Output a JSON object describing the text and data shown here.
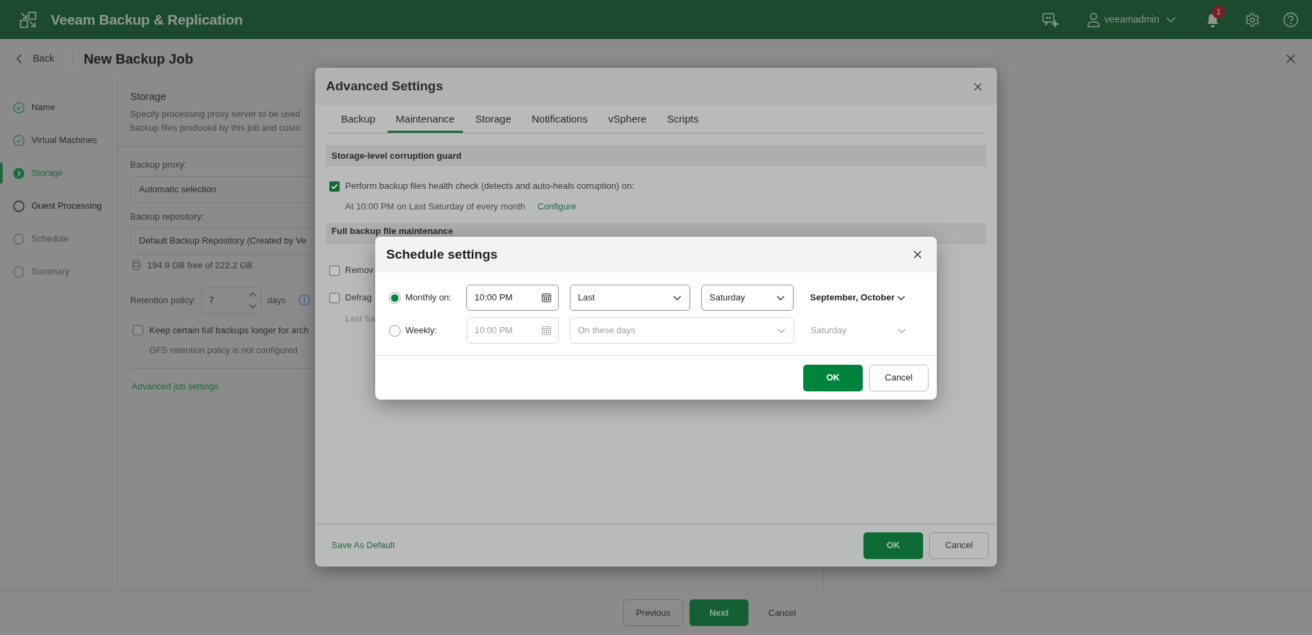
{
  "app": {
    "title": "Veeam Backup & Replication",
    "user": "veeamadmin",
    "notification_count": "1"
  },
  "header": {
    "back": "Back",
    "title": "New Backup Job"
  },
  "steps": [
    {
      "label": "Name",
      "completed": true,
      "disabled": false,
      "selected": false
    },
    {
      "label": "Virtual Machines",
      "completed": true,
      "disabled": false,
      "selected": false
    },
    {
      "label": "Storage",
      "completed": false,
      "disabled": false,
      "selected": true
    },
    {
      "label": "Guest Processing",
      "completed": false,
      "disabled": false,
      "selected": false
    },
    {
      "label": "Schedule",
      "completed": false,
      "disabled": true,
      "selected": false
    },
    {
      "label": "Summary",
      "completed": false,
      "disabled": true,
      "selected": false
    }
  ],
  "storage": {
    "title": "Storage",
    "description": [
      "Specify processing proxy server to be used",
      "backup files produced by this job and custo"
    ],
    "proxy": {
      "label": "Backup proxy:",
      "value": "Automatic selection"
    },
    "repository": {
      "label": "Backup repository:",
      "value": "Default Backup Repository (Created by Ve",
      "free": "194.9 GB free of 222.2 GB"
    },
    "retention": {
      "label": "Retention policy:",
      "value": "7",
      "unit": "days"
    },
    "gfs": {
      "label": "Keep certain full backups longer for arch",
      "checked": false,
      "note": "GFS retention policy is not configured"
    },
    "advanced_link": "Advanced job settings"
  },
  "advanced_settings": {
    "title": "Advanced Settings",
    "tabs": [
      {
        "label": "Backup",
        "selected": false
      },
      {
        "label": "Maintenance",
        "selected": true
      },
      {
        "label": "Storage",
        "selected": false
      },
      {
        "label": "Notifications",
        "selected": false
      },
      {
        "label": "vSphere",
        "selected": false
      },
      {
        "label": "Scripts",
        "selected": false
      }
    ],
    "sections": [
      {
        "title": "Storage-level corruption guard",
        "items": [
          {
            "label": "Perform backup files health check (detects and auto-heals corruption) on:",
            "checked": true,
            "detail": "At 10:00 PM on Last Saturday of every month",
            "link": "Configure"
          }
        ]
      },
      {
        "title": "Full backup file maintenance",
        "items": [
          {
            "label": "Remov",
            "checked": false
          },
          {
            "label": "Defrag",
            "checked": false,
            "detail": "Last Sa"
          }
        ]
      }
    ],
    "footer_link": "Save As Default",
    "buttons": [
      {
        "label": "OK",
        "kind": "primary"
      },
      {
        "label": "Cancel",
        "kind": "secondary"
      }
    ]
  },
  "schedule": {
    "title": "Schedule settings",
    "options": [
      {
        "label": "Monthly on:",
        "selected": true,
        "disabled": false,
        "fields": [
          {
            "kind": "time",
            "value": "10:00 PM"
          },
          {
            "kind": "select",
            "value": "Last"
          },
          {
            "kind": "select",
            "value": "Saturday"
          },
          {
            "kind": "plain",
            "value": "September, October"
          }
        ]
      },
      {
        "label": "Weekly:",
        "selected": false,
        "disabled": true,
        "fields": [
          {
            "kind": "time",
            "value": "10:00 PM"
          },
          {
            "kind": "wide",
            "value": "On these days"
          },
          {
            "kind": "plain",
            "value": "Saturday"
          }
        ]
      }
    ],
    "buttons": [
      {
        "label": "OK",
        "kind": "primary"
      },
      {
        "label": "Cancel",
        "kind": "secondary"
      }
    ]
  },
  "wizard_buttons": [
    {
      "label": "Previous",
      "kind": "secondary"
    },
    {
      "label": "Next",
      "kind": "primary"
    },
    {
      "label": "Cancel",
      "kind": "link"
    }
  ]
}
